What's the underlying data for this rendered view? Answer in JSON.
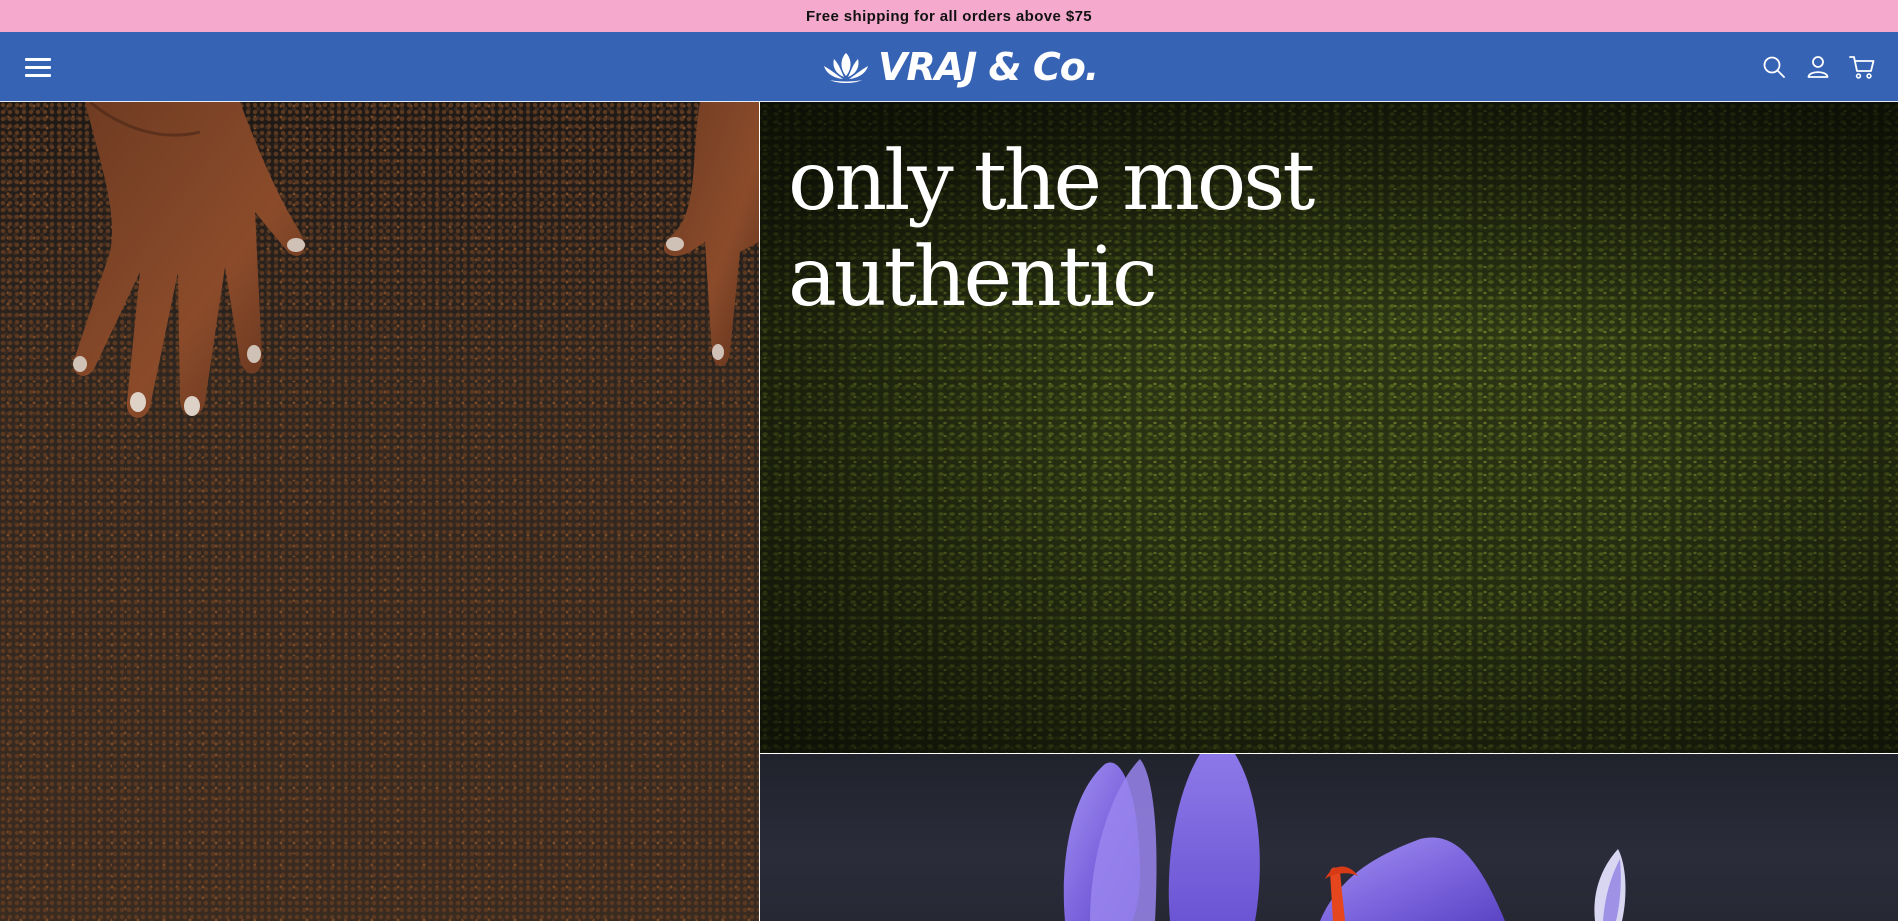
{
  "announcement": {
    "text": "Free shipping for all orders above $75"
  },
  "header": {
    "brand": "VRAJ & Co.",
    "icons": [
      "menu-icon",
      "lotus-icon",
      "search-icon",
      "account-icon",
      "cart-icon"
    ]
  },
  "hero": {
    "headline_line1": "only the most",
    "headline_line2": "authentic"
  },
  "colors": {
    "announcement_bg": "#f4a9cd",
    "header_bg": "#3763b5",
    "text_on_header": "#ffffff"
  }
}
